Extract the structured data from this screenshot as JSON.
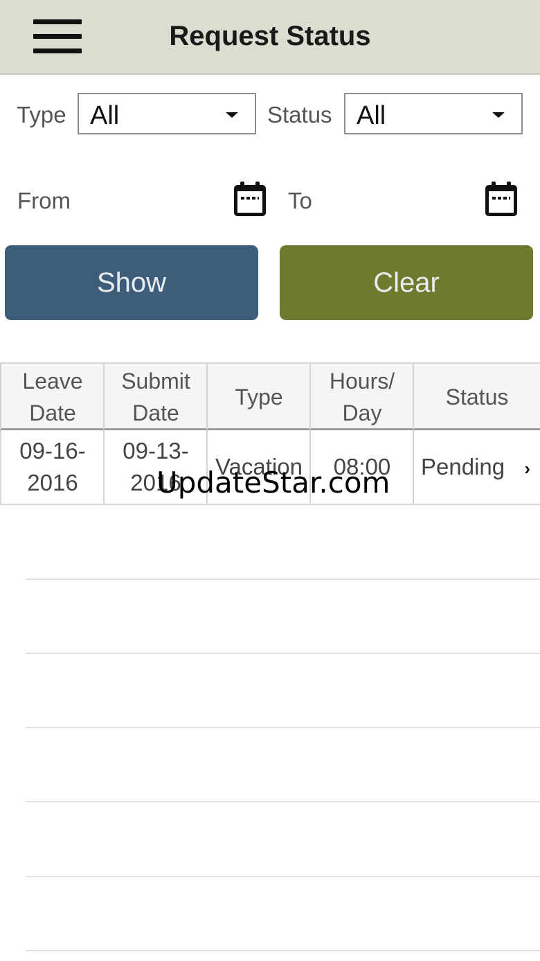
{
  "header": {
    "title": "Request Status",
    "menu_icon": "hamburger-menu-icon"
  },
  "filters": {
    "type_label": "Type",
    "type_value": "All",
    "status_label": "Status",
    "status_value": "All",
    "from_label": "From",
    "to_label": "To",
    "calendar_icon": "calendar-icon"
  },
  "buttons": {
    "show_label": "Show",
    "clear_label": "Clear",
    "show_color": "#3e5d7a",
    "clear_color": "#6e7a2e"
  },
  "table": {
    "columns": [
      "Leave Date",
      "Submit Date",
      "Type",
      "Hours/ Day",
      "Status"
    ],
    "rows": [
      {
        "leave_date": "09-16-2016",
        "submit_date": "09-13-2016",
        "type": "Vacation",
        "hours_day": "08:00",
        "status": "Pending"
      }
    ]
  },
  "watermark": "UpdateStar.com"
}
